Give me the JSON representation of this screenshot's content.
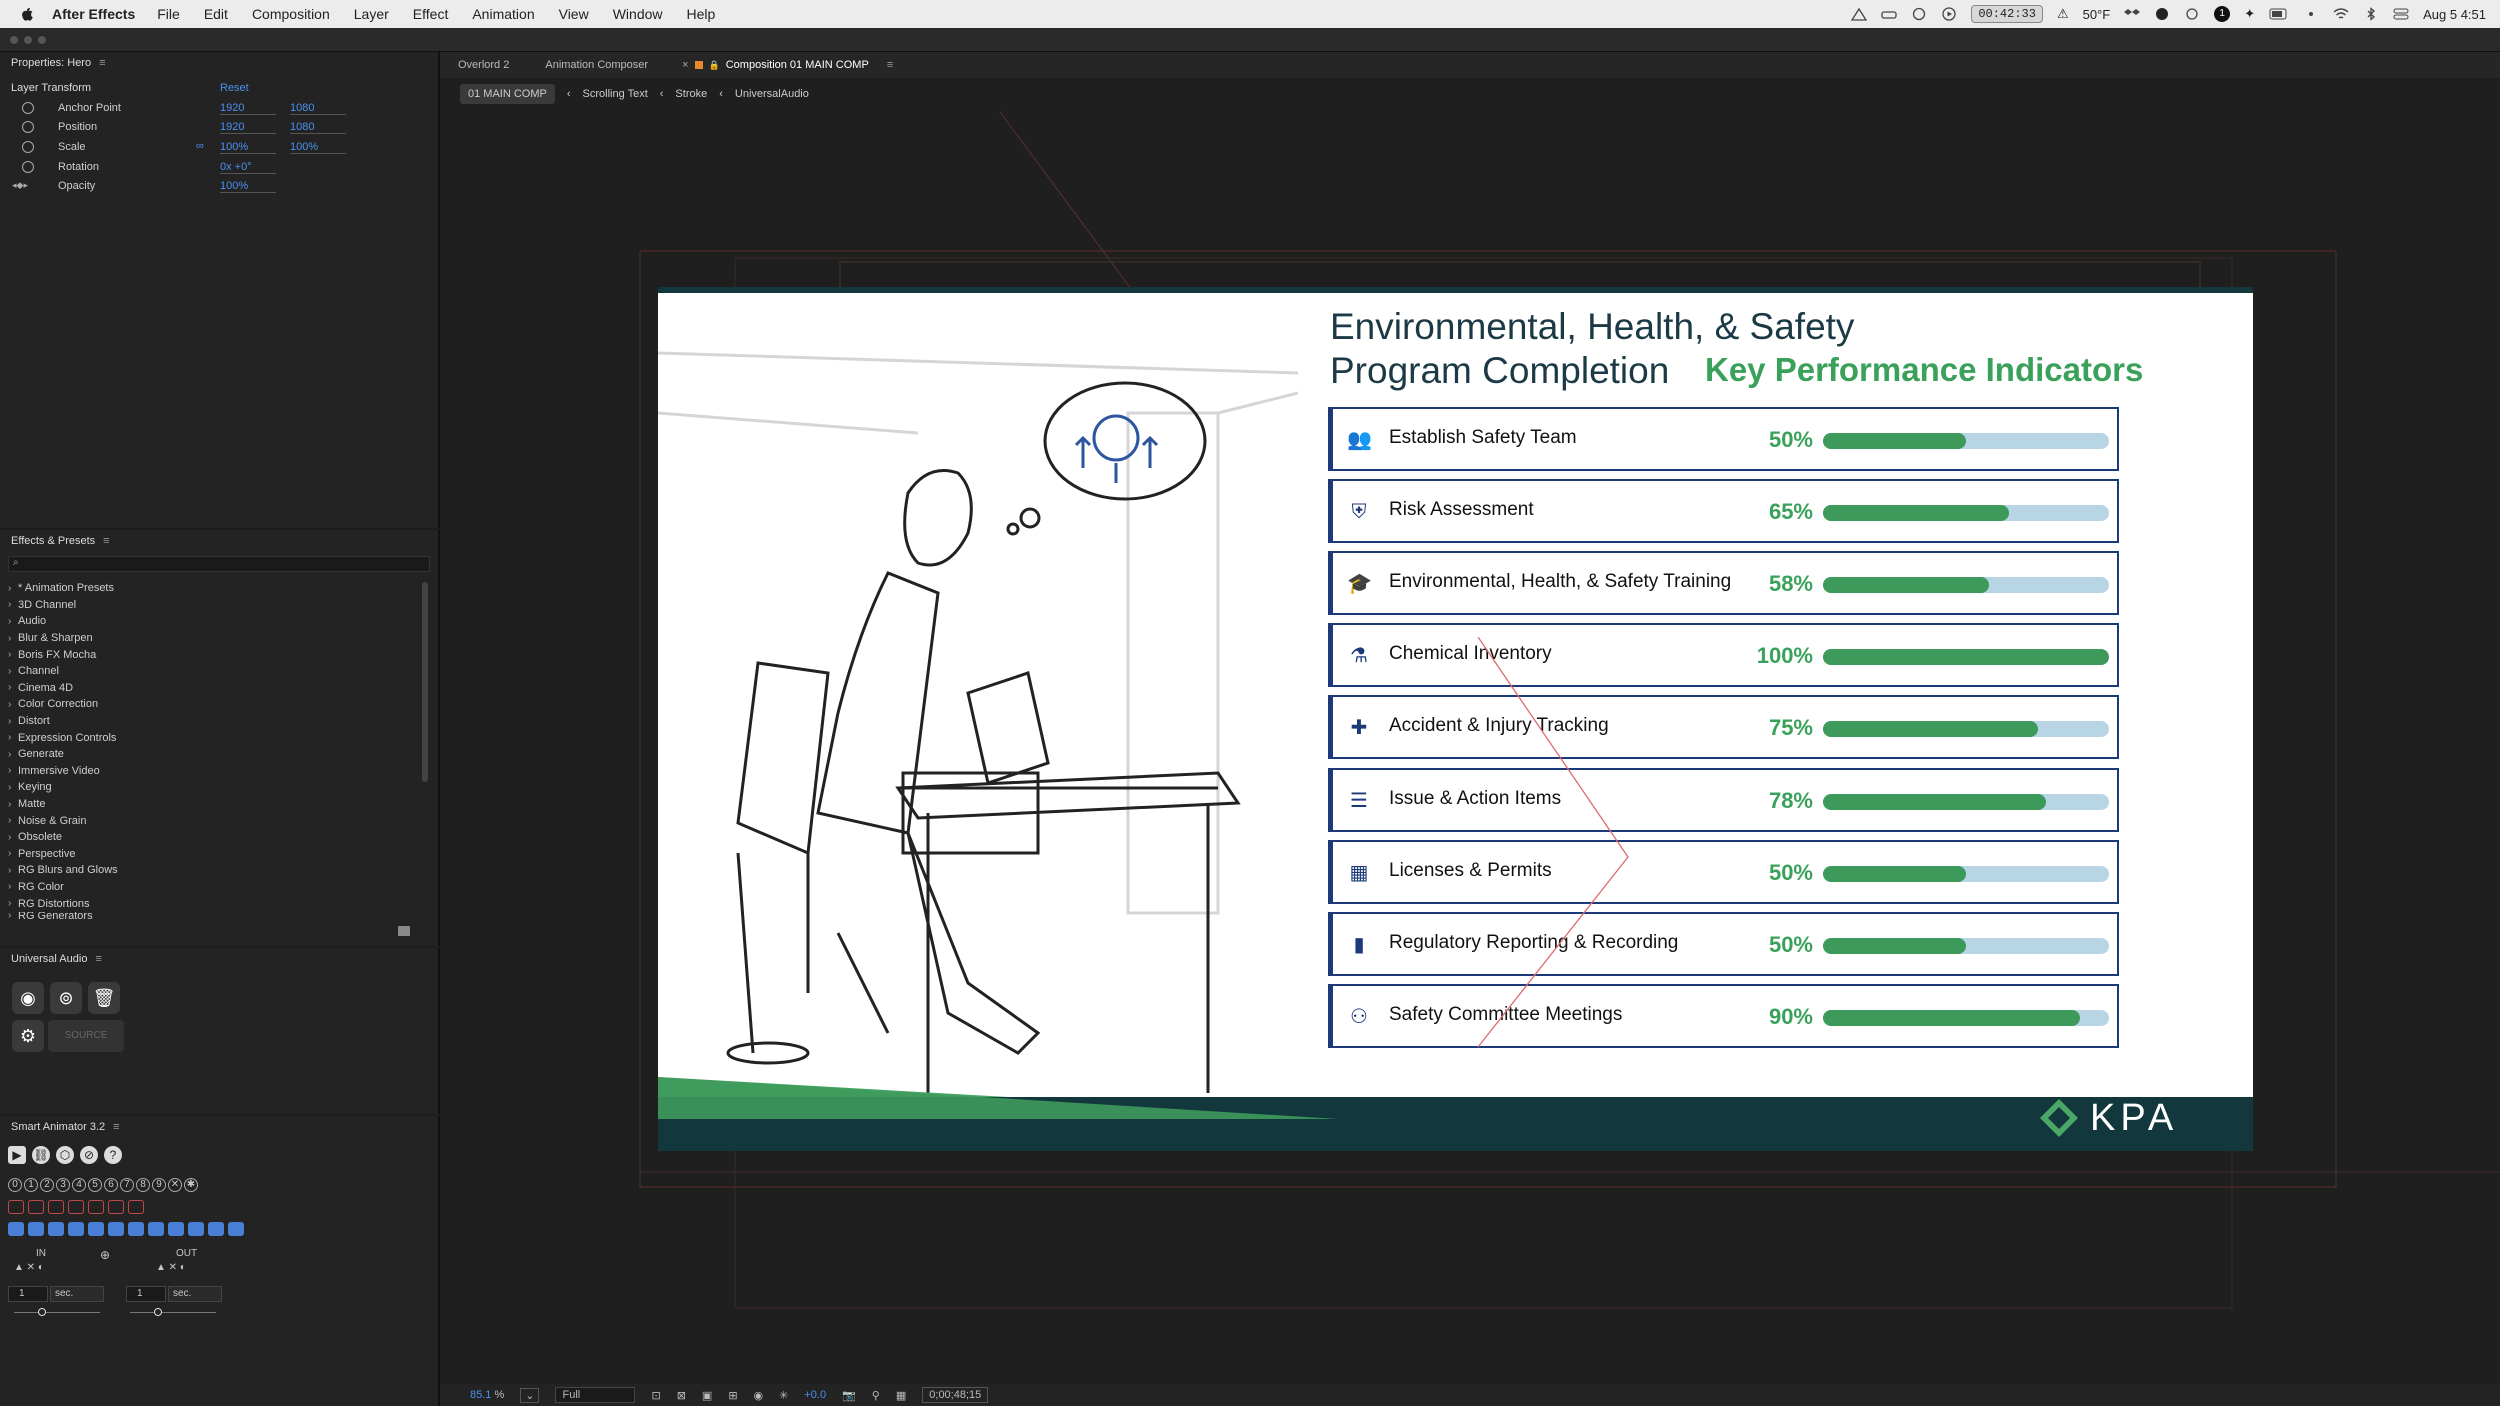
{
  "menubar": {
    "app_name": "After Effects",
    "items": [
      "File",
      "Edit",
      "Composition",
      "Layer",
      "Effect",
      "Animation",
      "View",
      "Window",
      "Help"
    ],
    "timer": "00:42:33",
    "weather": "50°F",
    "notification_count": "1",
    "datetime": "Aug 5  4:51"
  },
  "properties_panel": {
    "title": "Properties: Hero",
    "section": "Layer Transform",
    "reset_label": "Reset",
    "rows": [
      {
        "label": "Anchor Point",
        "v1": "1920",
        "v2": "1080"
      },
      {
        "label": "Position",
        "v1": "1920",
        "v2": "1080"
      },
      {
        "label": "Scale",
        "v1": "100%",
        "v2": "100%"
      },
      {
        "label": "Rotation",
        "v1": "0x +0°",
        "v2": ""
      },
      {
        "label": "Opacity",
        "v1": "100%",
        "v2": ""
      }
    ]
  },
  "effects_panel": {
    "title": "Effects & Presets",
    "search_placeholder": "",
    "items": [
      "* Animation Presets",
      "3D Channel",
      "Audio",
      "Blur & Sharpen",
      "Boris FX Mocha",
      "Channel",
      "Cinema 4D",
      "Color Correction",
      "Distort",
      "Expression Controls",
      "Generate",
      "Immersive Video",
      "Keying",
      "Matte",
      "Noise & Grain",
      "Obsolete",
      "Perspective",
      "RG Blurs and Glows",
      "RG Color",
      "RG Distortions",
      "RG Generators"
    ]
  },
  "universal_audio_panel": {
    "title": "Universal Audio",
    "source_label": "SOURCE"
  },
  "smart_animator_panel": {
    "title": "Smart Animator 3.2",
    "digits": [
      "0",
      "1",
      "2",
      "3",
      "4",
      "5",
      "6",
      "7",
      "8",
      "9"
    ],
    "in_label": "IN",
    "out_label": "OUT",
    "in_value": "1",
    "in_unit": "sec.",
    "out_value": "1",
    "out_unit": "sec."
  },
  "viewer": {
    "tabs": [
      "Overlord 2",
      "Animation Composer",
      "Composition 01 MAIN COMP"
    ],
    "breadcrumbs": [
      "01 MAIN COMP",
      "Scrolling Text",
      "Stroke",
      "UniversalAudio"
    ]
  },
  "statusbar": {
    "zoom": "85.1",
    "zoom_unit": "%",
    "resolution": "Full",
    "exposure": "+0.0",
    "timecode": "0;00;48;15"
  },
  "slide": {
    "title_line1": "Environmental, Health, & Safety",
    "title_line2": "Program Completion",
    "subtitle": "Key Performance Indicators",
    "logo": "KPA",
    "colors": {
      "navy": "#1c3a7a",
      "green": "#3aa15a",
      "bar_track": "#b8d5e6",
      "dark_band": "#12373d"
    },
    "kpis": [
      {
        "icon": "team-icon",
        "name": "Establish Safety Team",
        "pct": "50%",
        "value": 0.5
      },
      {
        "icon": "shield-icon",
        "name": "Risk Assessment",
        "pct": "65%",
        "value": 0.65
      },
      {
        "icon": "graduation-cap-icon",
        "name": "Environmental, Health, & Safety Training",
        "pct": "58%",
        "value": 0.58
      },
      {
        "icon": "flask-icon",
        "name": "Chemical Inventory",
        "pct": "100%",
        "value": 1.0
      },
      {
        "icon": "first-aid-icon",
        "name": "Accident & Injury Tracking",
        "pct": "75%",
        "value": 0.75
      },
      {
        "icon": "list-icon",
        "name": "Issue & Action Items",
        "pct": "78%",
        "value": 0.78
      },
      {
        "icon": "calendar-icon",
        "name": "Licenses & Permits",
        "pct": "50%",
        "value": 0.5
      },
      {
        "icon": "bar-chart-icon",
        "name": "Regulatory Reporting & Recording",
        "pct": "50%",
        "value": 0.5
      },
      {
        "icon": "meeting-icon",
        "name": "Safety Committee Meetings",
        "pct": "90%",
        "value": 0.9
      }
    ]
  }
}
